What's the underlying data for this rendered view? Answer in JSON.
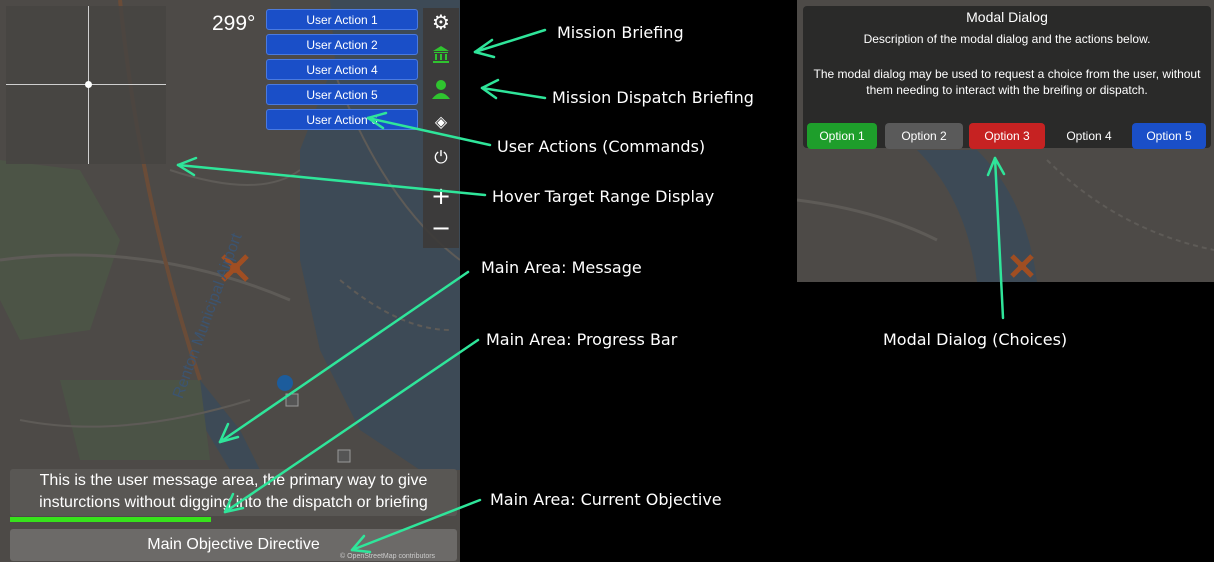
{
  "hud": {
    "heading": "299°",
    "user_actions": [
      "User Action 1",
      "User Action 2",
      "User Action 4",
      "User Action 5",
      "User Action 6"
    ],
    "toolbar_icons": [
      "gear-icon",
      "bank-icon",
      "dispatcher-icon",
      "layers-icon",
      "timer-icon",
      "zoom-in-icon",
      "zoom-out-icon"
    ],
    "toolbar_glyphs": {
      "gear": "⚙",
      "bank": "🏛",
      "dispatcher": "👤",
      "layers": "◈",
      "timer": "⏻",
      "zoom_in": "+",
      "zoom_out": "−"
    },
    "message": "This is the user message area, the primary way to give insturctions without digging into the dispatch or briefing",
    "progress": 0.45,
    "objective": "Main Objective Directive",
    "attribution": "© OpenStreetMap contributors",
    "map_label": "Renton Municipal Airport"
  },
  "modal": {
    "title": "Modal Dialog",
    "description": "Description of the modal dialog and the actions below.",
    "body": "The modal dialog may be used to request a choice from the user, without them needing to interact with the breifing or dispatch.",
    "options": [
      {
        "label": "Option 1",
        "color": "#1e9e2b"
      },
      {
        "label": "Option 2",
        "color": "#5a5a5a"
      },
      {
        "label": "Option 3",
        "color": "#c62222"
      },
      {
        "label": "Option 4",
        "color": "transparent"
      },
      {
        "label": "Option 5",
        "color": "#1a4fc8"
      }
    ]
  },
  "annotations": {
    "mission_briefing": "Mission Briefing",
    "mission_dispatch": "Mission Dispatch Briefing",
    "user_actions": "User Actions (Commands)",
    "hover_range": "Hover Target Range Display",
    "main_message": "Main Area: Message",
    "main_progress": "Main Area: Progress Bar",
    "main_objective": "Main Area: Current Objective",
    "modal_choices": "Modal Dialog (Choices)"
  },
  "colors": {
    "arrow": "#2fe59a",
    "action_blue": "#1a4fc8",
    "progress_green": "#37e21c"
  }
}
